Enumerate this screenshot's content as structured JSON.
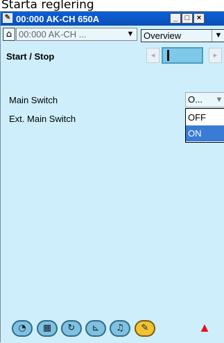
{
  "outer_title": "Starta reglering",
  "window": {
    "title": "00:000 AK-CH 650A",
    "minimize_label": "_",
    "maximize_label": "□",
    "close_label": "×"
  },
  "toolbar": {
    "home_icon": "home-icon",
    "device_select_value": "00:000 AK-CH ...",
    "view_select_value": "Overview"
  },
  "section": {
    "title": "Start / Stop",
    "page_value": "|"
  },
  "parameters": [
    {
      "label": "Main Switch",
      "value": "O..."
    },
    {
      "label": "Ext. Main Switch"
    }
  ],
  "dropdown": {
    "options": [
      "OFF",
      "ON"
    ],
    "selected": "ON"
  },
  "bottom_tabs": [
    {
      "icon": "overview-icon"
    },
    {
      "icon": "grid-icon"
    },
    {
      "icon": "refresh-icon"
    },
    {
      "icon": "graph-icon"
    },
    {
      "icon": "bell-icon"
    },
    {
      "icon": "wrench-icon",
      "active": true
    }
  ],
  "alarm_icon": "alarm-icon",
  "colors": {
    "titlebar": "#0b57c8",
    "background": "#cdeefa",
    "selected_item": "#3a7bd5",
    "alarm": "#e0141c"
  }
}
